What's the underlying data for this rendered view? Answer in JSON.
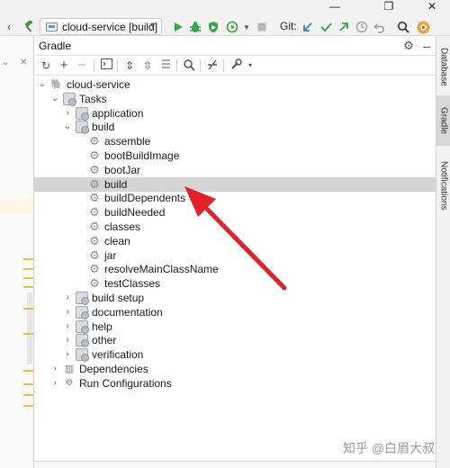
{
  "toolbar": {
    "run_config": "cloud-service [build]",
    "git_label": "Git:",
    "icons": [
      "hammer-icon",
      "run-icon",
      "debug-icon",
      "coverage-icon",
      "profile-icon",
      "stop-icon",
      "git-update-icon",
      "git-commit-icon",
      "git-push-icon",
      "history-icon",
      "rollback-icon",
      "search-icon",
      "ide-logo-icon"
    ]
  },
  "window_controls": {
    "minimize": "—",
    "restore": "❐",
    "close": "✕"
  },
  "gradle": {
    "title": "Gradle",
    "tree": [
      {
        "label": "cloud-service",
        "kind": "project"
      },
      {
        "label": "Tasks",
        "kind": "folder"
      },
      {
        "label": "application",
        "kind": "folder"
      },
      {
        "label": "build",
        "kind": "folder"
      },
      {
        "label": "assemble",
        "kind": "task"
      },
      {
        "label": "bootBuildImage",
        "kind": "task"
      },
      {
        "label": "bootJar",
        "kind": "task"
      },
      {
        "label": "build",
        "kind": "task",
        "selected": true
      },
      {
        "label": "buildDependents",
        "kind": "task"
      },
      {
        "label": "buildNeeded",
        "kind": "task"
      },
      {
        "label": "classes",
        "kind": "task"
      },
      {
        "label": "clean",
        "kind": "task"
      },
      {
        "label": "jar",
        "kind": "task"
      },
      {
        "label": "resolveMainClassName",
        "kind": "task"
      },
      {
        "label": "testClasses",
        "kind": "task"
      },
      {
        "label": "build setup",
        "kind": "folder"
      },
      {
        "label": "documentation",
        "kind": "folder"
      },
      {
        "label": "help",
        "kind": "folder"
      },
      {
        "label": "other",
        "kind": "folder"
      },
      {
        "label": "verification",
        "kind": "folder"
      },
      {
        "label": "Dependencies",
        "kind": "dependencies"
      },
      {
        "label": "Run Configurations",
        "kind": "run-configurations"
      }
    ]
  },
  "side_tabs": {
    "database": "Database",
    "gradle": "Gradle",
    "notifications": "Notifications"
  },
  "watermark": "知乎 @白眉大叔",
  "colors": {
    "selection": "#d5d5d5",
    "annotation_arrow": "#e0222a",
    "run_green": "#3aa84a"
  }
}
